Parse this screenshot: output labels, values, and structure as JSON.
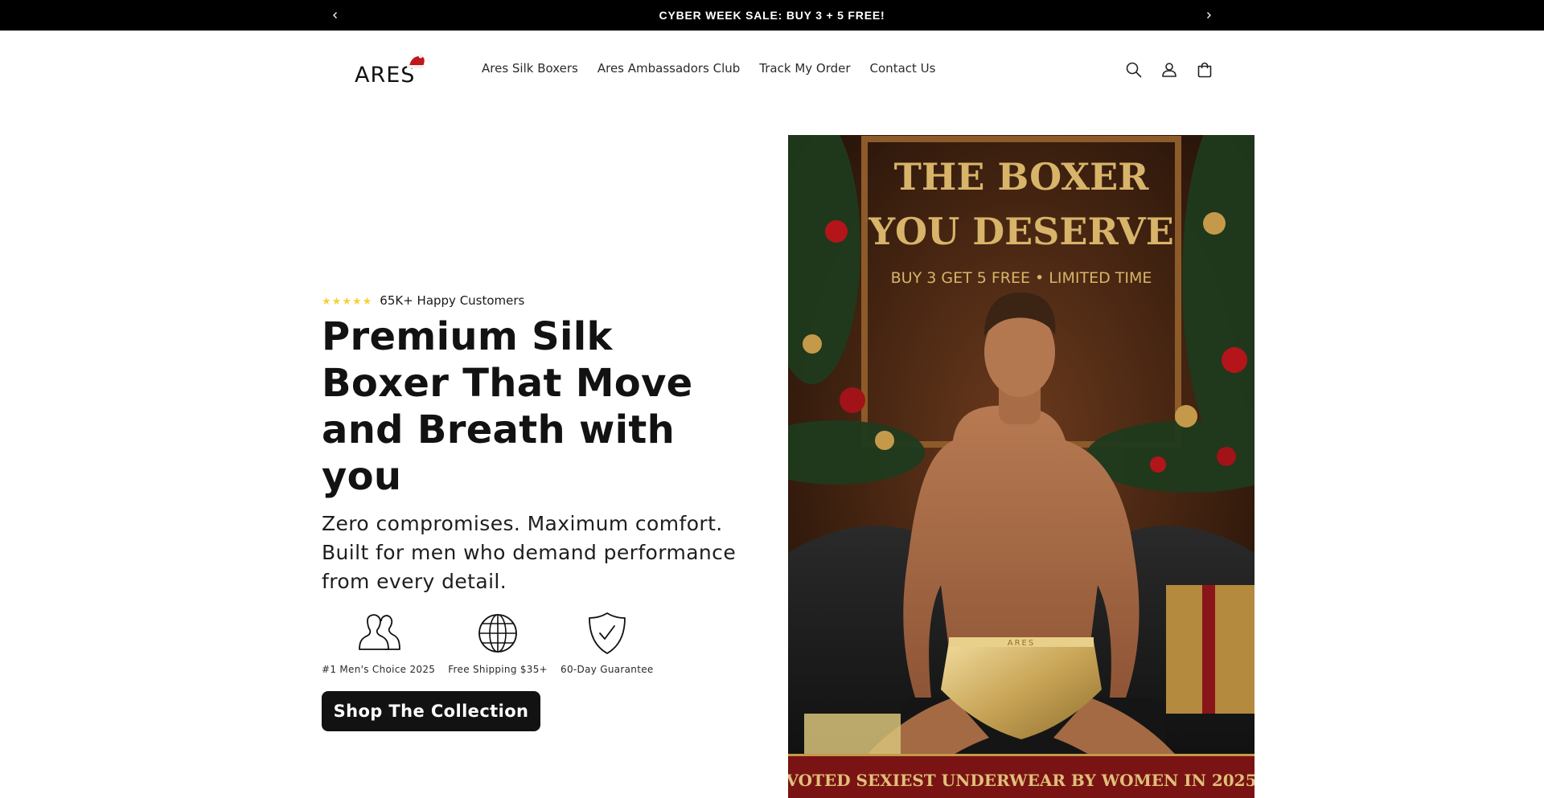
{
  "announcement": {
    "text": "CYBER WEEK SALE: BUY 3 + 5 FREE!",
    "prev_icon": "chevron-left-icon",
    "next_icon": "chevron-right-icon"
  },
  "header": {
    "logo_text": "ARES",
    "nav": [
      {
        "label": "Ares Silk Boxers"
      },
      {
        "label": "Ares Ambassadors Club"
      },
      {
        "label": "Track My Order"
      },
      {
        "label": "Contact Us"
      }
    ],
    "icons": [
      "search-icon",
      "account-icon",
      "cart-icon"
    ]
  },
  "hero": {
    "rating": {
      "stars": 5,
      "text": "65K+ Happy Customers"
    },
    "heading": "Premium Silk Boxer That Move and Breath with you",
    "subheading": "Zero compromises. Maximum comfort. Built for men who demand performance from every detail.",
    "features": [
      {
        "icon": "people-icon",
        "label": "#1 Men's Choice 2025"
      },
      {
        "icon": "globe-icon",
        "label": "Free Shipping $35+"
      },
      {
        "icon": "shield-check-icon",
        "label": "60-Day Guarantee"
      }
    ],
    "cta_label": "Shop The Collection"
  },
  "banner": {
    "line1": "THE BOXER",
    "line2": "YOU DESERVE",
    "offer": "BUY 3 GET 5 FREE • LIMITED TIME",
    "ribbon": "VOTED SEXIEST UNDERWEAR BY WOMEN IN 2025",
    "waistband": "ARES",
    "colors": {
      "gold": "#d8b46a",
      "ribbon": "#7a1414",
      "background": "#3b2112"
    }
  }
}
